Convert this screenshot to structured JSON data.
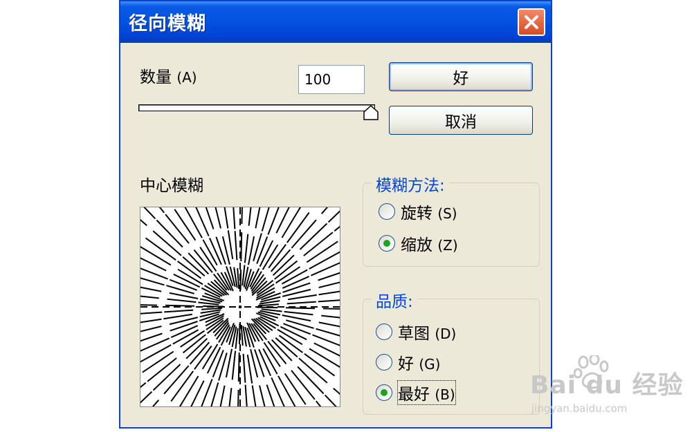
{
  "dialog": {
    "title": "径向模糊",
    "amount_label": "数量",
    "amount_mnemonic": "(A)",
    "amount_value": "100",
    "amount_level_percent": 100,
    "ok_label": "好",
    "cancel_label": "取消",
    "center_label": "中心模糊"
  },
  "method_group": {
    "legend": "模糊方法:",
    "options": [
      {
        "label": "旋转",
        "mnemonic": "(S)",
        "selected": false
      },
      {
        "label": "缩放",
        "mnemonic": "(Z)",
        "selected": true
      }
    ]
  },
  "quality_group": {
    "legend": "品质:",
    "options": [
      {
        "label": "草图",
        "mnemonic": "(D)",
        "selected": false
      },
      {
        "label": "好",
        "mnemonic": "(G)",
        "selected": false
      },
      {
        "label": "最好",
        "mnemonic": "(B)",
        "selected": true
      }
    ]
  },
  "watermark": {
    "brand": "Bai du 经验",
    "url": "jingyan.baidu.com"
  },
  "colors": {
    "title_bar": "#0352e0",
    "dialog_bg": "#ece9d8",
    "legend_text": "#0046d5",
    "radio_selected": "#21a121"
  }
}
